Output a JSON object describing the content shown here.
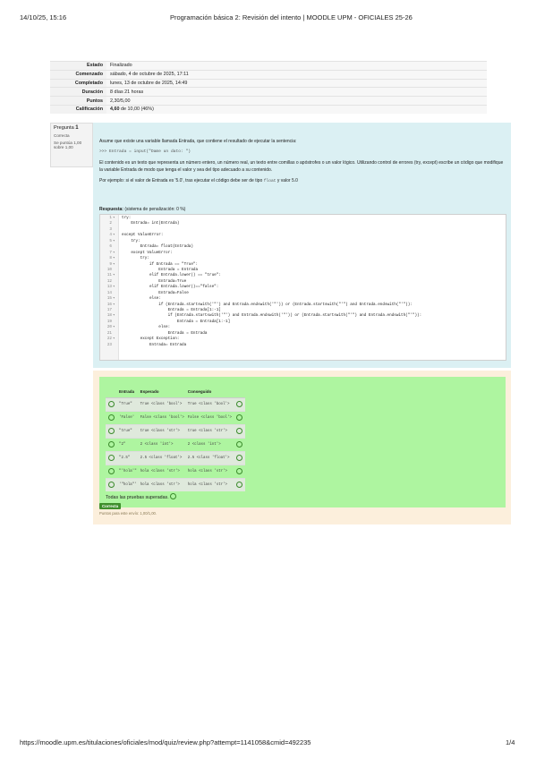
{
  "page_header": {
    "datetime": "14/10/25, 15:16",
    "title": "Programación básica 2: Revisión del intento | MOODLE UPM - OFICIALES 25-26"
  },
  "summary": [
    {
      "label": "Estado",
      "value": "Finalizado"
    },
    {
      "label": "Comenzado",
      "value": "sábado, 4 de octubre de 2025, 17:11"
    },
    {
      "label": "Completado",
      "value": "lunes, 13 de octubre de 2025, 14:49"
    },
    {
      "label": "Duración",
      "value": "8 días 21 horas"
    },
    {
      "label": "Puntos",
      "value": "2,30/5,00"
    },
    {
      "label": "Calificación",
      "value_bold": "4,60",
      "value_rest": " de 10,00 (46%)"
    }
  ],
  "question_info": {
    "prefix": "Pregunta",
    "number": "1",
    "state": "Correcta",
    "grade": "Se puntúa 1,00 sobre 1,00"
  },
  "question": {
    "intro": "Asume que existe una variable llamada Entrada, que contiene el resultado de ejecutar la sentencia:",
    "code_sample": ">>> Entrada = input(\"Dame un dato: \")",
    "body": "El contenido es un texto que representa un número entero, un número real, un texto entre comillas o apóstrofes o un valor lógico. Utilizando control de errores (try, except) escribe un código que modifique la variable Entrada de modo que tenga el valor y sea del tipo adecuado a su contenido.",
    "example_prefix": "Por ejemplo: si el valor de Entrada es '5.0', tras ejecutar el código debe ser de tipo ",
    "example_code": "float",
    "example_suffix": " y valor 5.0",
    "answer_label": "Respuesta:",
    "penalty": "(sistema de penalización: 0 %)"
  },
  "code_lines": [
    {
      "n": "1",
      "fold": "▾",
      "text": "try:"
    },
    {
      "n": "2",
      "fold": "",
      "text": "    Entrada= int(Entrada)"
    },
    {
      "n": "3",
      "fold": "",
      "text": ""
    },
    {
      "n": "4",
      "fold": "▾",
      "text": "except ValueError:"
    },
    {
      "n": "5",
      "fold": "▾",
      "text": "    try:"
    },
    {
      "n": "6",
      "fold": "",
      "text": "        Entrada= float(Entrada)"
    },
    {
      "n": "7",
      "fold": "▾",
      "text": "    except ValueError:"
    },
    {
      "n": "8",
      "fold": "▾",
      "text": "        try:"
    },
    {
      "n": "9",
      "fold": "▾",
      "text": "            if Entrada == \"True\":"
    },
    {
      "n": "10",
      "fold": "",
      "text": "                Entrada = Entrada"
    },
    {
      "n": "11",
      "fold": "▾",
      "text": "            elif Entrada.lower() == \"true\":"
    },
    {
      "n": "12",
      "fold": "",
      "text": "                Entrada=True"
    },
    {
      "n": "13",
      "fold": "▾",
      "text": "            elif Entrada.lower()==\"false\":"
    },
    {
      "n": "14",
      "fold": "",
      "text": "                Entrada=False"
    },
    {
      "n": "15",
      "fold": "▾",
      "text": "            else:"
    },
    {
      "n": "16",
      "fold": "▾",
      "text": "                if (Entrada.startswith('\"') and Entrada.endswith('\"')) or (Entrada.startswith(\"'\") and Entrada.endswith(\"'\")):"
    },
    {
      "n": "17",
      "fold": "",
      "text": "                    Entrada = Entrada[1:-1]"
    },
    {
      "n": "18",
      "fold": "▾",
      "text": "                    if (Entrada.startswith('\"') and Entrada.endswith('\"')) or (Entrada.startswith(\"'\") and Entrada.endswith(\"'\")):"
    },
    {
      "n": "19",
      "fold": "",
      "text": "                        Entrada = Entrada[1:-1]"
    },
    {
      "n": "20",
      "fold": "▾",
      "text": "                else:"
    },
    {
      "n": "21",
      "fold": "",
      "text": "                    Entrada = Entrada"
    },
    {
      "n": "22",
      "fold": "▾",
      "text": "        except Exception:"
    },
    {
      "n": "23",
      "fold": "",
      "text": "            Entrada= Entrada"
    }
  ],
  "tests": {
    "headers": [
      "Entrada",
      "Esperado",
      "Conseguido"
    ],
    "rows": [
      {
        "entrada": "\"True\"",
        "esperado": "True <class 'bool'>",
        "conseguido": "True <class 'bool'>"
      },
      {
        "entrada": "'False'",
        "esperado": "False <class 'bool'>",
        "conseguido": "False <class 'bool'>"
      },
      {
        "entrada": "\"true\"",
        "esperado": "true <class 'str'>",
        "conseguido": "true <class 'str'>"
      },
      {
        "entrada": "\"2\"",
        "esperado": "2 <class 'int'>",
        "conseguido": "2 <class 'int'>"
      },
      {
        "entrada": "\"2.5\"",
        "esperado": "2.5 <class 'float'>",
        "conseguido": "2.5 <class 'float'>"
      },
      {
        "entrada": "\"'hola'\"",
        "esperado": "hola <class 'str'>",
        "conseguido": "hola <class 'str'>"
      },
      {
        "entrada": "'\"hola\"'",
        "esperado": "hola <class 'str'>",
        "conseguido": "hola <class 'str'>"
      }
    ],
    "passed_text": "Todas las pruebas superadas."
  },
  "result": {
    "badge": "Correcta",
    "score": "Puntos para este envío: 1,00/1,00."
  },
  "page_footer": {
    "url": "https://moodle.upm.es/titulaciones/oficiales/mod/quiz/review.php?attempt=1141058&cmid=492235",
    "page": "1/4"
  },
  "colors": {
    "question_bg": "#dbf0f3",
    "outcome_bg": "#fcefdc",
    "tests_bg": "#aef5a0",
    "correct_badge": "#3f8f2c"
  }
}
